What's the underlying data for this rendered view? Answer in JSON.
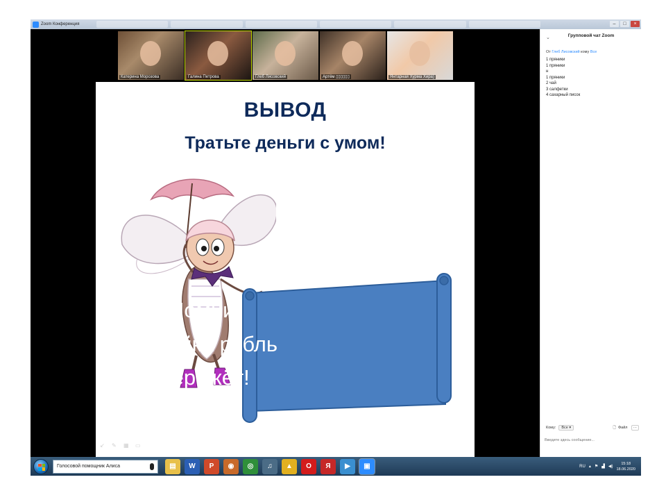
{
  "window": {
    "title": "Zoom Конференция"
  },
  "participants": [
    {
      "name": "Катерина Морозова"
    },
    {
      "name": "Галина Петрова"
    },
    {
      "name": "Глеб Лисовский"
    },
    {
      "name": "Артём ▯▯▯▯▯▯"
    },
    {
      "name": "Янтарная Хурма Хира)"
    }
  ],
  "slide": {
    "title": "ВЫВОД",
    "subtitle": "Тратьте деньги с умом!",
    "scroll_lines": [
      "Помни!",
      "Копейка рубль",
      "бережёт!"
    ]
  },
  "chat": {
    "header": "Групповой чат Zoom",
    "from_prefix": "От",
    "from_name": "Глеб Лисовский",
    "to_word": "кому",
    "to_name": "Все",
    "messages": [
      "1 пряники",
      "1 пряники",
      "н",
      "1 пряники",
      "2 чай",
      "3 салфетки",
      "4 сахарный писок"
    ],
    "to_label": "Кому:",
    "recipient": "Все",
    "file_label": "Файл",
    "more_label": "···",
    "input_placeholder": "Введите здесь сообщение..."
  },
  "taskbar": {
    "assistant_label": "Голосовой помощник Алиса",
    "language": "RU",
    "time": "15:18",
    "date": "18.06.2020"
  },
  "colors": {
    "slide_title": "#0e2a5a",
    "scroll_fill": "#4a7fc1",
    "zoom_blue": "#2d8cff",
    "active_speaker": "#c3e000"
  }
}
